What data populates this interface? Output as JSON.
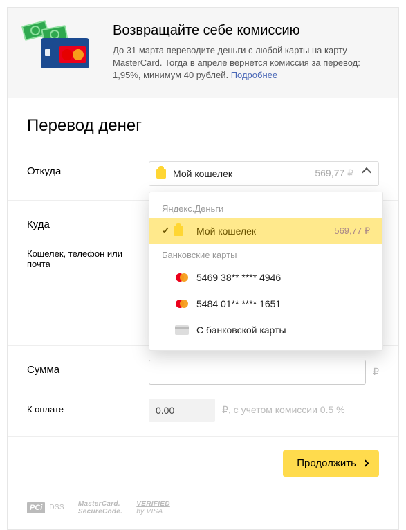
{
  "promo": {
    "title": "Возвращайте себе комиссию",
    "body_prefix": "До 31 марта переводите деньги с любой карты на карту MasterCard. Тогда в апреле вернется комиссия за перевод: 1,95%, минимум 40 рублей. ",
    "link_text": "Подробнее"
  },
  "title": "Перевод денег",
  "from": {
    "label": "Откуда",
    "selected_text": "Мой кошелек",
    "selected_balance": "569,77 "
  },
  "dropdown": {
    "group1_title": "Яндекс.Деньги",
    "wallet_text": "Мой кошелек",
    "wallet_balance": "569,77 ",
    "group2_title": "Банковские карты",
    "card1": "5469 38** **** 4946",
    "card2": "5484 01** **** 1651",
    "other_card": "С банковской карты"
  },
  "to": {
    "label": "Куда"
  },
  "recipient": {
    "label": "Кошелек, телефон или почта"
  },
  "sum": {
    "label": "Сумма",
    "currency": "₽"
  },
  "topay": {
    "label": "К оплате",
    "value": "0.00",
    "note": "₽, с учетом комиссии 0.5 %"
  },
  "actions": {
    "continue": "Продолжить"
  },
  "logos": {
    "pci": "PCi",
    "pci_suffix": "DSS",
    "mc1": "MasterCard.",
    "mc2": "SecureCode.",
    "vbv1": "VERIFIED",
    "vbv2": "by VISA"
  },
  "rub_symbol": "₽"
}
